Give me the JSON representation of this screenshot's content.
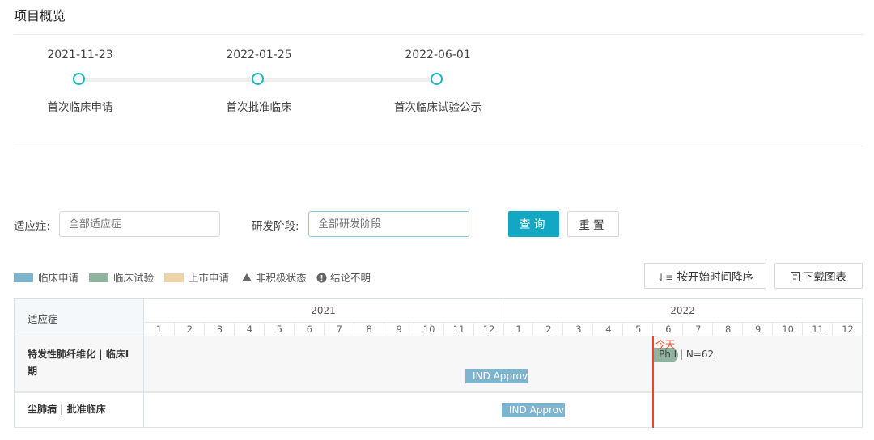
{
  "page": {
    "title": "项目概览"
  },
  "milestones": [
    {
      "date": "2021-11-23",
      "name": "首次临床申请"
    },
    {
      "date": "2022-01-25",
      "name": "首次批准临床"
    },
    {
      "date": "2022-06-01",
      "name": "首次临床试验公示"
    }
  ],
  "filters": {
    "indication_label": "适应症:",
    "indication_placeholder": "全部适应症",
    "phase_label": "研发阶段:",
    "phase_placeholder": "全部研发阶段",
    "query_label": "查询",
    "reset_label": "重置"
  },
  "legend": {
    "items": [
      {
        "label": "临床申请",
        "color": "#7fb4ce"
      },
      {
        "label": "临床试验",
        "color": "#8fb39c"
      },
      {
        "label": "上市申请",
        "color": "#eed3a8"
      }
    ],
    "inactive_label": "非积极状态",
    "unclear_label": "结论不明"
  },
  "actions": {
    "sort_label": "按开始时间降序",
    "download_label": "下载图表"
  },
  "gantt": {
    "header_label": "适应症",
    "years": [
      "2021",
      "2022"
    ],
    "months": [
      "1",
      "2",
      "3",
      "4",
      "5",
      "6",
      "7",
      "8",
      "9",
      "10",
      "11",
      "12",
      "1",
      "2",
      "3",
      "4",
      "5",
      "6",
      "7",
      "8",
      "9",
      "10",
      "11",
      "12"
    ],
    "today_label": "今天",
    "rows": [
      {
        "label_line1": "特发性肺纤维化 | 临床I",
        "label_line2": "期",
        "bars": [
          {
            "label": "Ph I | N=62",
            "type": "trial"
          },
          {
            "label": "IND Approval",
            "type": "application"
          }
        ]
      },
      {
        "label_line1": "尘肺病 | 批准临床",
        "bars": [
          {
            "label": "IND Approval",
            "type": "application"
          }
        ]
      }
    ]
  },
  "colors": {
    "accent": "#12a7c2",
    "milestone": "#1bb3c0",
    "application": "#7fb4ce",
    "trial": "#8fb39c",
    "today": "#e8472e"
  }
}
